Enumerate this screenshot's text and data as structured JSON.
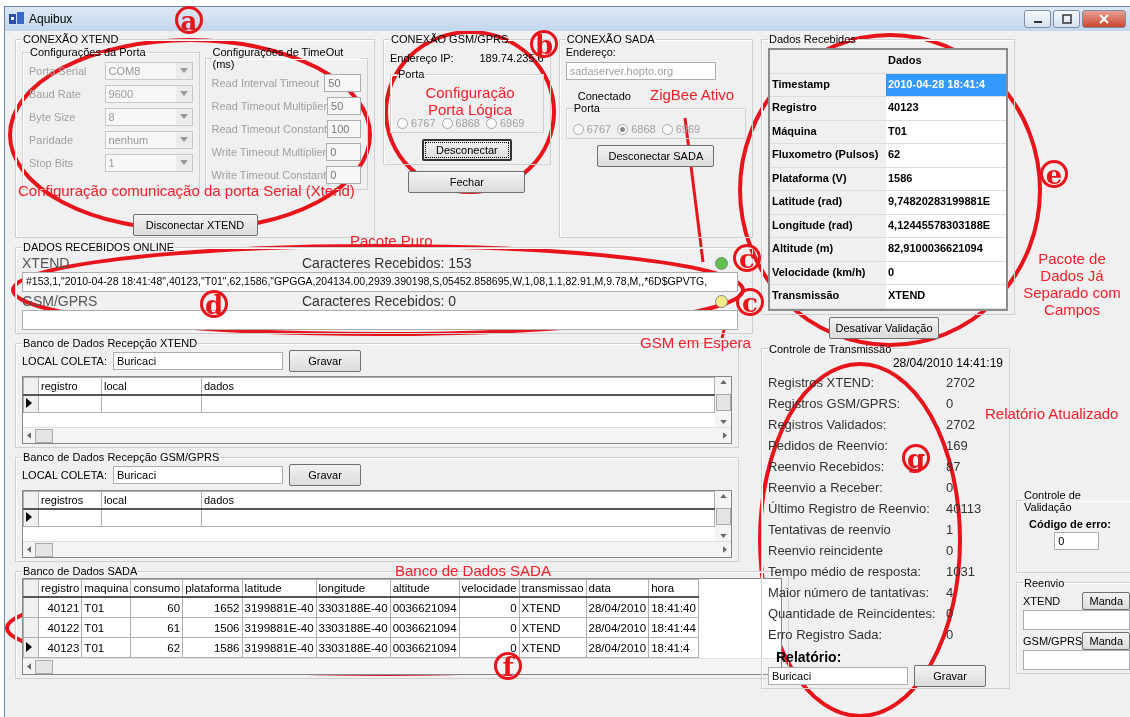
{
  "window": {
    "title": "Aquibux"
  },
  "xtend": {
    "title": "CONEXÃO XTEND",
    "port_config": {
      "title": "Configurações da Porta",
      "fields": [
        {
          "label": "Porta Serial",
          "value": "COM8",
          "disabled": true
        },
        {
          "label": "Baud Rate",
          "value": "9600",
          "disabled": true
        },
        {
          "label": "Byte Size",
          "value": "8",
          "disabled": true
        },
        {
          "label": "Paridade",
          "value": "nenhum",
          "disabled": true
        },
        {
          "label": "Stop Bits",
          "value": "1",
          "disabled": true
        }
      ]
    },
    "timeout_config": {
      "title": "Configurações de TimeOut (ms)",
      "fields": [
        {
          "label": "Read Interval Timeout",
          "value": "50",
          "disabled": true
        },
        {
          "label": "Read Timeout Multiplier",
          "value": "50",
          "disabled": true
        },
        {
          "label": "Read Timeout Constant",
          "value": "100",
          "disabled": true
        },
        {
          "label": "Write Timeout Multiplier",
          "value": "0",
          "disabled": true
        },
        {
          "label": "Write Timeout Constant",
          "value": "0",
          "disabled": true
        }
      ]
    },
    "button": "Disconectar XTEND"
  },
  "gsm": {
    "title": "CONEXÃO GSM/GPRS",
    "ip_label": "Endereço IP:",
    "ip": "189.74.235.6",
    "port_title": "Porta",
    "radios": [
      {
        "label": "6767",
        "selected": false,
        "disabled": true
      },
      {
        "label": "6868",
        "selected": false,
        "disabled": true
      },
      {
        "label": "6969",
        "selected": false,
        "disabled": true
      }
    ],
    "button": "Desconectar"
  },
  "close_button": "Fechar",
  "sada": {
    "title": "CONEXÃO SADA",
    "address_label": "Endereço:",
    "address": "sadaserver.hopto.org",
    "status": "Conectado",
    "port_title": "Porta",
    "radios": [
      {
        "label": "6767",
        "selected": false,
        "disabled": true
      },
      {
        "label": "6868",
        "selected": true,
        "disabled": true
      },
      {
        "label": "6969",
        "selected": false,
        "disabled": true
      }
    ],
    "button": "Desconectar SADA"
  },
  "online": {
    "title": "DADOS RECEBIDOS ONLINE",
    "channels": [
      {
        "name": "XTEND",
        "count": "Caracteres Recebidos: 153",
        "packet": "#153,1,\"2010-04-28 18:41:48\",40123,\"T01\",62,1586,\"GPGGA,204134.00,2939.390198,S,05452.858695,W,1,08,1.1,82.91,M,9.78,M,,*6D$GPVTG,",
        "color": "#5cc24a"
      },
      {
        "name": "GSM/GPRS",
        "count": "Caracteres Recebidos: 0",
        "color": "#f2ec8a"
      }
    ]
  },
  "db_xtend": {
    "title": "Banco de Dados Recepção XTEND",
    "local_label": "LOCAL COLETA:",
    "local": "Buricaci",
    "button": "Gravar",
    "columns": [
      "registro",
      "local",
      "dados"
    ]
  },
  "db_gsm": {
    "title": "Banco de Dados Recepção GSM/GPRS",
    "local_label": "LOCAL COLETA:",
    "local": "Buricaci",
    "button": "Gravar",
    "columns": [
      "registros",
      "local",
      "dados"
    ]
  },
  "db_sada": {
    "title": "Banco de Dados SADA",
    "columns": [
      "registro",
      "maquina",
      "consumo",
      "plataforma",
      "latitude",
      "longitude",
      "altitude",
      "velocidade",
      "transmissao",
      "data",
      "hora"
    ],
    "rows": [
      {
        "cells": [
          "40121",
          "T01",
          "60",
          "1652",
          "3199881E-40",
          "3303188E-40",
          "0036621094",
          "0",
          "XTEND",
          "28/04/2010",
          "18:41:40"
        ],
        "selected": false
      },
      {
        "cells": [
          "40122",
          "T01",
          "61",
          "1506",
          "3199881E-40",
          "3303188E-40",
          "0036621094",
          "0",
          "XTEND",
          "28/04/2010",
          "18:41:44"
        ],
        "selected": false
      },
      {
        "cells": [
          "40123",
          "T01",
          "62",
          "1586",
          "3199881E-40",
          "3303188E-40",
          "0036621094",
          "0",
          "XTEND",
          "28/04/2010",
          "18:41:4"
        ],
        "selected": true
      }
    ]
  },
  "received": {
    "title": "Dados Recebidos",
    "header": "Dados",
    "rows": [
      {
        "field": "Timestamp",
        "value": "2010-04-28 18:41:4",
        "selected": true
      },
      {
        "field": "Registro",
        "value": "40123",
        "selected": false
      },
      {
        "field": "Máquina",
        "value": "T01",
        "selected": false
      },
      {
        "field": "Fluxometro (Pulsos)",
        "value": "62",
        "selected": false
      },
      {
        "field": "Plataforma (V)",
        "value": "1586",
        "selected": false
      },
      {
        "field": "Latitude (rad)",
        "value": "9,74820283199881E",
        "selected": false
      },
      {
        "field": "Longitude (rad)",
        "value": "4,12445578303188E",
        "selected": false
      },
      {
        "field": "Altitude (m)",
        "value": "82,9100036621094",
        "selected": false
      },
      {
        "field": "Velocidade (km/h)",
        "value": "0",
        "selected": false
      },
      {
        "field": "Transmissão",
        "value": "XTEND",
        "selected": false
      }
    ]
  },
  "validation_button": "Desativar Validação",
  "transmission": {
    "title": "Controle de Transmissão",
    "timestamp": "28/04/2010 14:41:19",
    "stats": [
      {
        "label": "Registros XTEND:",
        "value": "2702"
      },
      {
        "label": "Registros GSM/GPRS:",
        "value": "0"
      },
      {
        "label": "Registros Validados:",
        "value": "2702"
      },
      {
        "label": "Pedidos de Reenvio:",
        "value": "169"
      },
      {
        "label": "Reenvio Recebidos:",
        "value": "87"
      },
      {
        "label": "Reenvio a Receber:",
        "value": "0"
      },
      {
        "label": "Último Registro de Reenvio:",
        "value": "40113"
      },
      {
        "label": "Tentativas de reenvio",
        "value": "1"
      },
      {
        "label": "Reenvio reincidente",
        "value": "0"
      },
      {
        "label": "Tempo médio de resposta:",
        "value": "1031"
      },
      {
        "label": "Maior número de tantativas:",
        "value": "4"
      },
      {
        "label": "Quantidade de Reincidentes:",
        "value": "0"
      },
      {
        "label": "Erro Registro Sada:",
        "value": "0"
      }
    ],
    "report_label": "Relatório:",
    "report": "Buricaci",
    "button": "Gravar"
  },
  "validation": {
    "title": "Controle de Validação",
    "label": "Código de erro:",
    "value": "0"
  },
  "resend": {
    "title": "Reenvio",
    "items": [
      {
        "label": "XTEND",
        "button": "Manda"
      },
      {
        "label": "GSM/GPRS",
        "button": "Manda"
      }
    ]
  },
  "annotations": {
    "markers": [
      "a",
      "b",
      "c",
      "c",
      "d",
      "e",
      "f",
      "g"
    ],
    "notes": [
      "Configuração comunicação da porta Serial (Xtend)",
      "Configuração Porta Lógica",
      "Pacote Puro",
      "ZigBee Ativo",
      "GSM em Espera",
      "Pacote de Dados Já Separado com Campos",
      "Relatório Atualizado",
      "Banco de Dados SADA"
    ]
  }
}
